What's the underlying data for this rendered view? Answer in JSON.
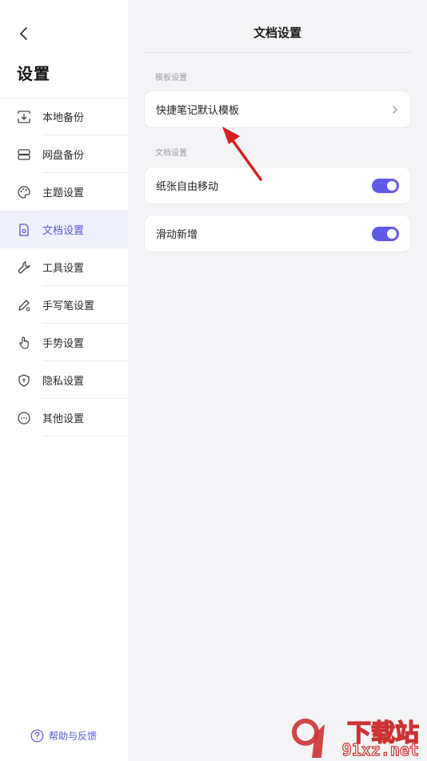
{
  "sidebar": {
    "title": "设置",
    "items": [
      {
        "label": "本地备份",
        "icon": "local-backup-icon"
      },
      {
        "label": "网盘备份",
        "icon": "cloud-drive-icon"
      },
      {
        "label": "主题设置",
        "icon": "palette-icon"
      },
      {
        "label": "文档设置",
        "icon": "document-settings-icon",
        "active": true
      },
      {
        "label": "工具设置",
        "icon": "wrench-icon"
      },
      {
        "label": "手写笔设置",
        "icon": "pen-icon"
      },
      {
        "label": "手势设置",
        "icon": "hand-gesture-icon"
      },
      {
        "label": "隐私设置",
        "icon": "shield-icon"
      },
      {
        "label": "其他设置",
        "icon": "more-icon"
      }
    ],
    "help_label": "帮助与反馈"
  },
  "content": {
    "title": "文档设置",
    "sections": [
      {
        "label": "模板设置",
        "rows": [
          {
            "label": "快捷笔记默认模板",
            "control": "chevron"
          }
        ]
      },
      {
        "label": "文档设置",
        "rows": [
          {
            "label": "纸张自由移动",
            "control": "toggle",
            "on": true
          },
          {
            "label": "滑动新增",
            "control": "toggle",
            "on": true
          }
        ]
      }
    ]
  },
  "watermark": {
    "line1": "下载站",
    "line2": "91xz.net"
  },
  "colors": {
    "accent": "#5b57e0",
    "toggle_on": "#6159e8",
    "annotation_arrow": "#d42020"
  }
}
